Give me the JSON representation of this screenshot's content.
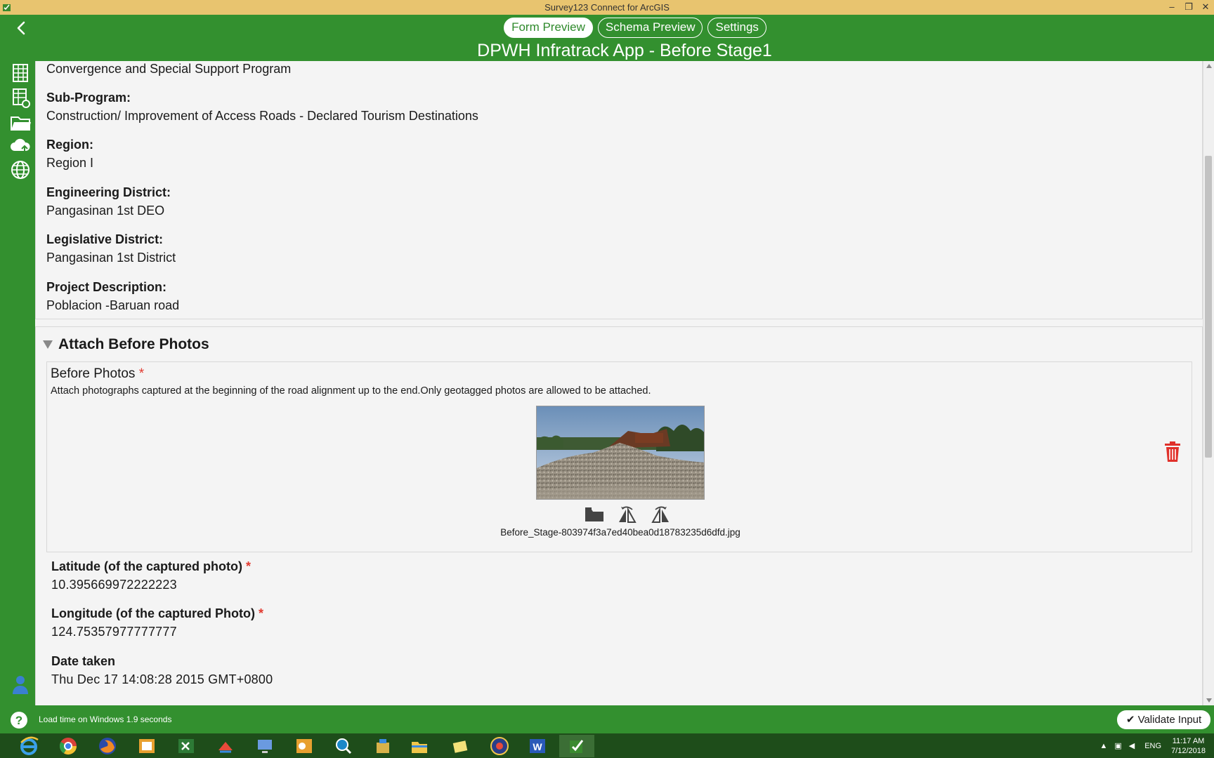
{
  "window": {
    "title": "Survey123 Connect for ArcGIS",
    "minimize": "–",
    "restore": "❐",
    "close": "✕"
  },
  "tabs": [
    {
      "label": "Form Preview",
      "active": true
    },
    {
      "label": "Schema Preview",
      "active": false
    },
    {
      "label": "Settings",
      "active": false
    }
  ],
  "form_title": "DPWH Infratrack App - Before Stage1",
  "fields": [
    {
      "label": "",
      "value": "Convergence and Special Support Program"
    },
    {
      "label": "Sub-Program:",
      "value": "Construction/ Improvement of Access Roads - Declared Tourism Destinations"
    },
    {
      "label": "Region:",
      "value": "Region I"
    },
    {
      "label": "Engineering District:",
      "value": "Pangasinan 1st DEO"
    },
    {
      "label": "Legislative District:",
      "value": "Pangasinan 1st District"
    },
    {
      "label": "Project Description:",
      "value": "Poblacion -Baruan road"
    }
  ],
  "photos_group": {
    "title": "Attach Before Photos",
    "question_label": "Before Photos",
    "required_mark": "*",
    "hint": "Attach photographs captured at the beginning of the road alignment up to the end.Only geotagged photos are allowed to be attached.",
    "filename": "Before_Stage-803974f3a7ed40bea0d18783235d6dfd.jpg"
  },
  "photo_fields": [
    {
      "label": "Latitude (of the captured photo)",
      "required": "*",
      "value": "10.395669972222223"
    },
    {
      "label": "Longitude (of the captured Photo)",
      "required": "*",
      "value": "124.75357977777777"
    },
    {
      "label": "Date taken",
      "required": "",
      "value": "Thu Dec 17 14:08:28 2015 GMT+0800"
    }
  ],
  "status": {
    "text": "Load time on Windows 1.9 seconds",
    "validate_label": "Validate Input"
  },
  "tray": {
    "lang": "ENG",
    "time": "11:17 AM",
    "date": "7/12/2018"
  },
  "colors": {
    "green": "#33902f",
    "titlebar": "#e8c46f",
    "required": "#e23a30",
    "trash": "#e0302a"
  }
}
